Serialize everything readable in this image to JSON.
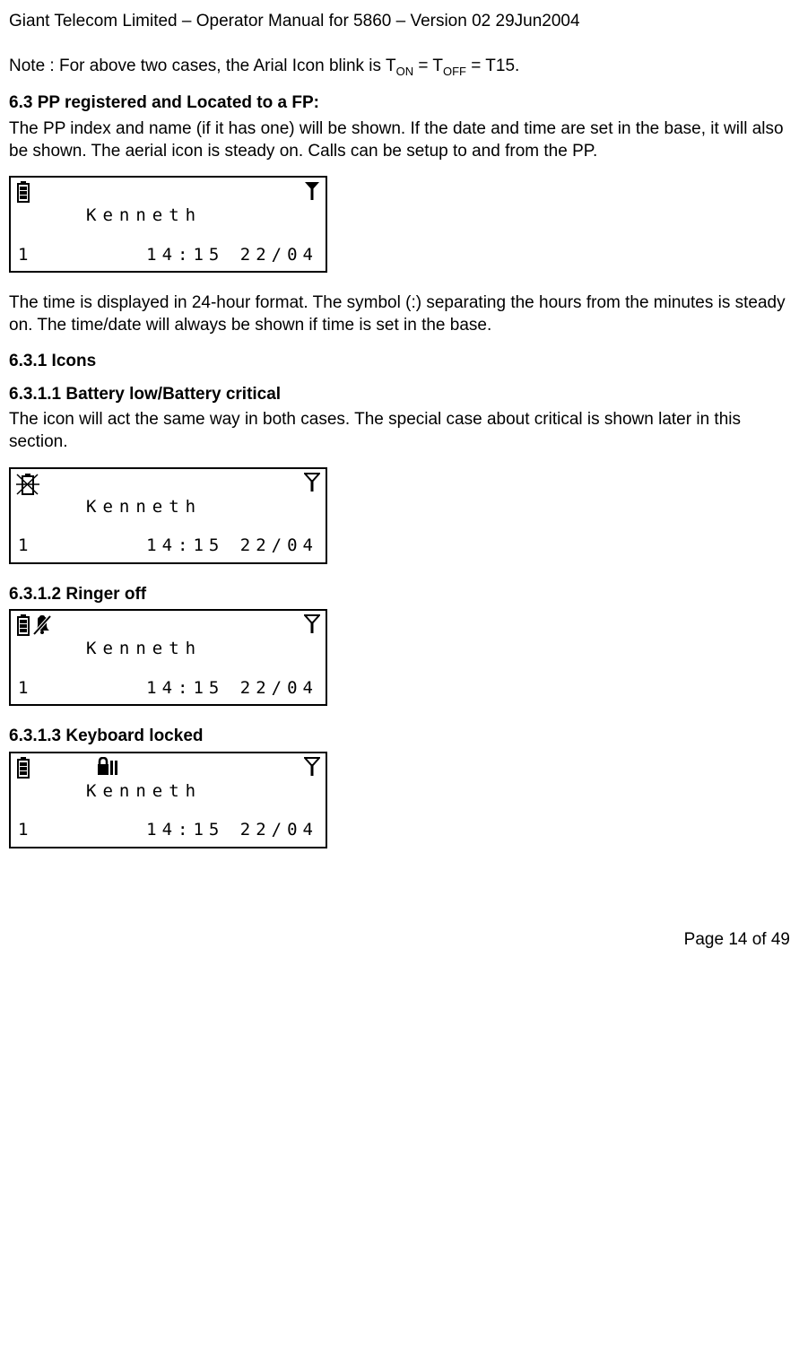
{
  "header": "Giant Telecom Limited – Operator Manual for 5860 – Version 02 29Jun2004",
  "note_prefix": "Note : For above two cases, the Arial Icon blink is T",
  "note_on": "ON",
  "note_mid": " = T",
  "note_off": "OFF",
  "note_end": " = T15.",
  "s63_title": "6.3   PP registered and Located to a FP:",
  "s63_body": "The PP index and name (if it has one) will be shown. If the date and time are set in the base, it will also be shown. The aerial icon is steady on. Calls can be setup to and from the PP.",
  "lcd": {
    "name": "Kenneth",
    "index": "1",
    "timedate": "14:15  22/04"
  },
  "s63_after": "The time is displayed in 24-hour format. The symbol (:) separating the hours from the minutes is steady on. The time/date will always be shown if time is set in the base.",
  "s631_title": "6.3.1   Icons",
  "s6311_title": "6.3.1.1   Battery low/Battery critical",
  "s6311_body": "The icon will act the same way in both cases. The special case about critical is shown later in this section.",
  "s6312_title": "6.3.1.2   Ringer off",
  "s6313_title": "6.3.1.3   Keyboard locked",
  "footer": "Page 14 of 49"
}
